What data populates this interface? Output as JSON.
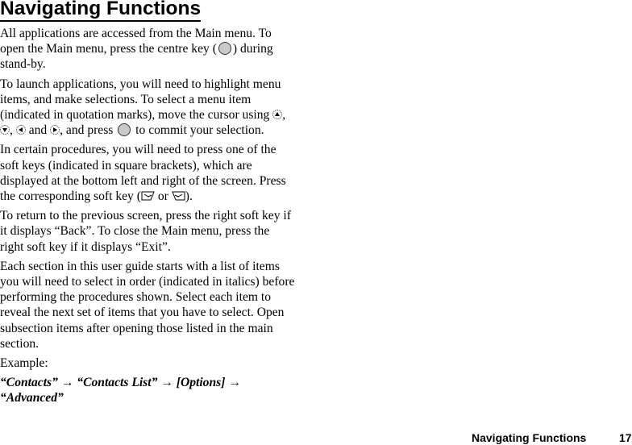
{
  "heading": "Navigating Functions",
  "paragraphs": {
    "p1": {
      "before_icon": "All applications are accessed from the Main menu. To open the Main menu, press the centre key (",
      "icon": "centre-key-icon",
      "after_icon": ") during stand-by."
    },
    "p2": {
      "part1": "To launch applications, you will need to highlight menu items, and make selections. To select a menu item (indicated in quotation marks), move the cursor using ",
      "icons": [
        "up-key-icon",
        "down-key-icon",
        "left-key-icon",
        "right-key-icon",
        "centre-key-icon"
      ],
      "sep1": ", ",
      "sep2": ", ",
      "sep3": " and ",
      "part2": ", and press ",
      "part3": " to commit your selection."
    },
    "p3": {
      "text": "In certain procedures, you will need to press one of the soft keys (indicated in square brackets), which are displayed at the bottom left and right of the screen. Press the corresponding soft key (",
      "icons": [
        "left-soft-key-icon",
        "right-soft-key-icon"
      ],
      "or": " or ",
      "end": ")."
    },
    "p4": "To return to the previous screen, press the right soft key if it displays “Back”. To close the Main menu, press the right soft key if it displays “Exit”.",
    "p5": "Each section in this user guide starts with a list of items you will need to select in order (indicated in italics) before performing the procedures shown. Select each item to reveal the next set of items that you have to select. Open subsection items after opening those listed in the main section.",
    "example_label": "Example:",
    "example_path": "“Contacts” → “Contacts List” → [Options] → “Advanced”"
  },
  "footer": {
    "section_title": "Navigating Functions",
    "page_number": "17"
  }
}
